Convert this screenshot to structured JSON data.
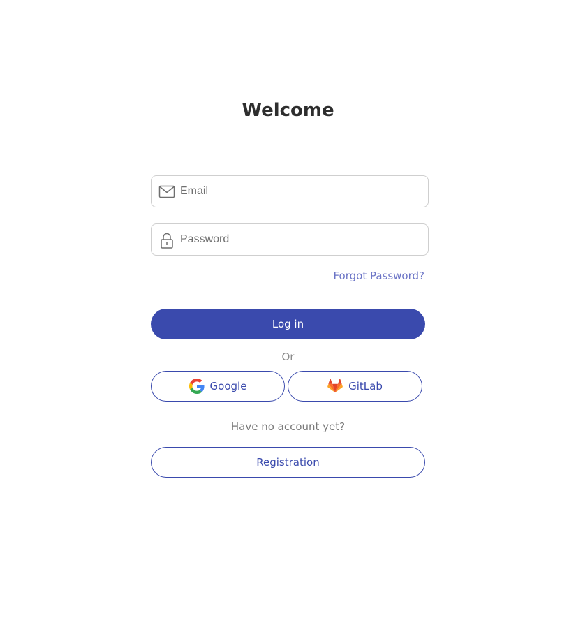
{
  "header": {
    "title": "Welcome"
  },
  "form": {
    "email": {
      "value": "",
      "placeholder": "Email",
      "icon": "envelope-icon"
    },
    "password": {
      "value": "",
      "placeholder": "Password",
      "icon": "lock-icon"
    },
    "forgot_password_label": "Forgot Password?",
    "login_label": "Log in"
  },
  "social": {
    "separator": "Or",
    "google_label": "Google",
    "google_icon": "google-icon",
    "gitlab_label": "GitLab",
    "gitlab_icon": "gitlab-icon"
  },
  "signup": {
    "prompt": "Have no account yet?",
    "registration_label": "Registration"
  },
  "colors": {
    "primary": "#3a4aad",
    "link": "#6b74c6",
    "border": "#cfcfcf",
    "text": "#2e2e2e",
    "muted": "#7a7a7a"
  }
}
